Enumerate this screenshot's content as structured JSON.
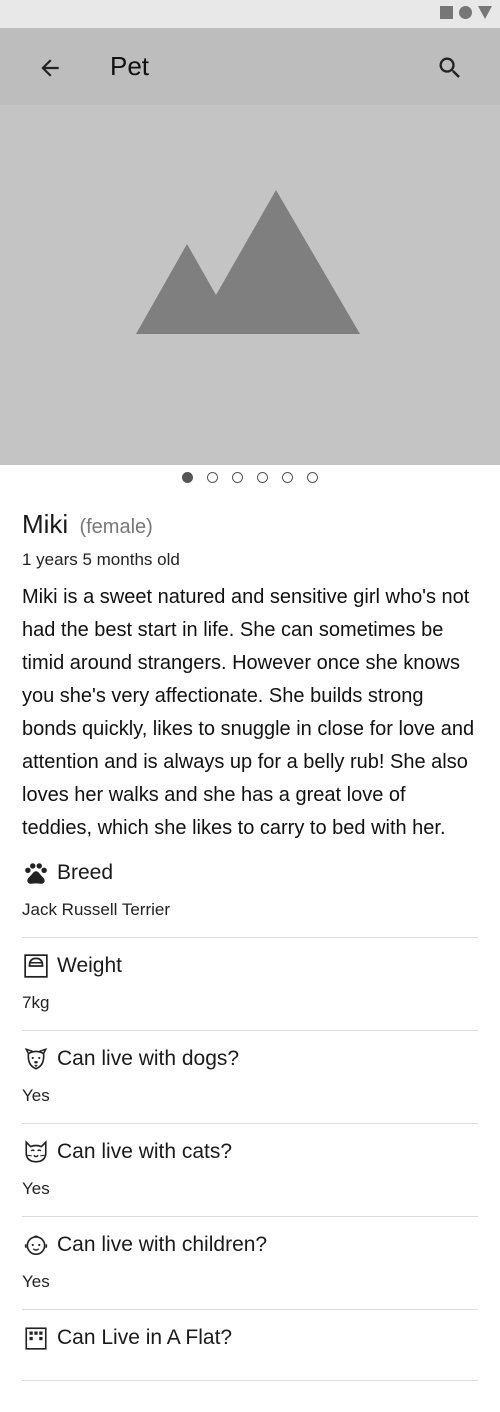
{
  "app_bar": {
    "title": "Pet"
  },
  "carousel": {
    "count": 6,
    "active_index": 0
  },
  "pet": {
    "name": "Miki",
    "gender": "(female)",
    "age": "1 years 5 months old",
    "description": "Miki is a sweet natured and sensitive girl who's not had the best start in life. She can sometimes be timid around strangers. However once she knows you she's very affectionate. She builds strong bonds quickly, likes to snuggle in close for love and attention and is always up for a belly rub! She also loves her walks and she has a great love of teddies, which she likes to carry to bed with her."
  },
  "attributes": [
    {
      "icon": "paw-icon",
      "label": "Breed",
      "value": "Jack Russell Terrier"
    },
    {
      "icon": "scale-icon",
      "label": "Weight",
      "value": "7kg"
    },
    {
      "icon": "dog-face-icon",
      "label": "Can live with dogs?",
      "value": "Yes"
    },
    {
      "icon": "cat-face-icon",
      "label": "Can live with cats?",
      "value": "Yes"
    },
    {
      "icon": "baby-face-icon",
      "label": "Can live with children?",
      "value": "Yes"
    },
    {
      "icon": "building-icon",
      "label": "Can Live in A Flat?",
      "value": ""
    }
  ],
  "colors": {
    "app_bar_bg": "#bdbdbd",
    "hero_bg": "#c4c4c4",
    "placeholder_mountain": "#7f7f7f"
  }
}
